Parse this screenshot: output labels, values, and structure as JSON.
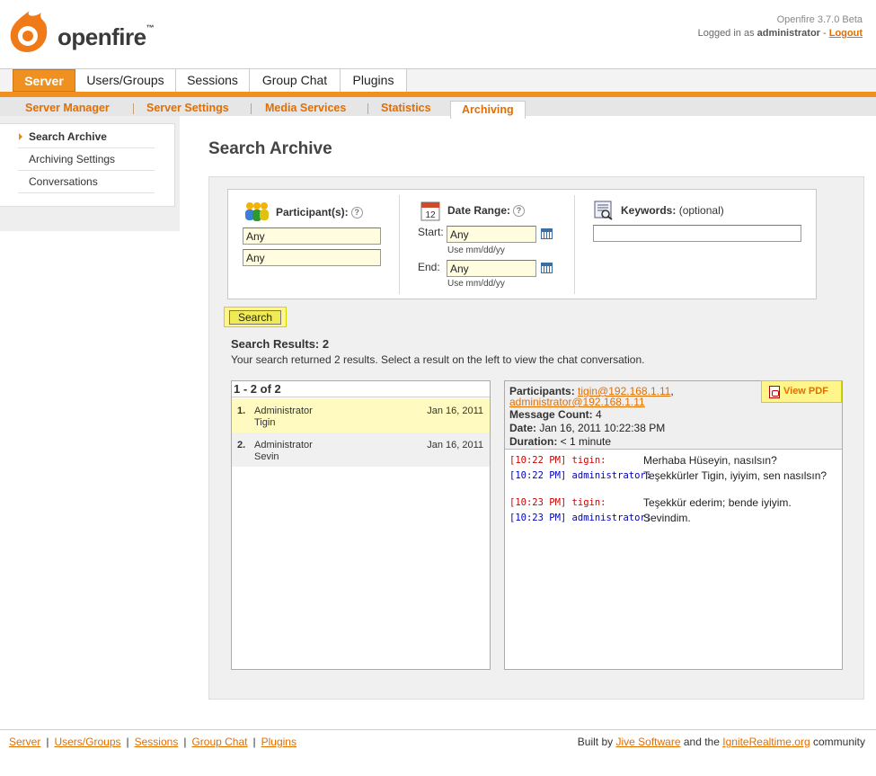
{
  "header": {
    "logo_text": "openfire",
    "logo_tm": "™",
    "version": "Openfire 3.7.0 Beta",
    "login_prefix": "Logged in as",
    "username": "administrator",
    "logout": "Logout"
  },
  "main_tabs": [
    "Server",
    "Users/Groups",
    "Sessions",
    "Group Chat",
    "Plugins"
  ],
  "sub_tabs": [
    "Server Manager",
    "Server Settings",
    "Media Services",
    "Statistics",
    "Archiving"
  ],
  "sidebar": {
    "items": [
      "Search Archive",
      "Archiving Settings",
      "Conversations"
    ]
  },
  "page_title": "Search Archive",
  "search": {
    "participants_label": "Participant(s):",
    "participant_1": "Any",
    "participant_2": "Any",
    "date_range_label": "Date Range:",
    "start_label": "Start:",
    "start_value": "Any",
    "end_label": "End:",
    "end_value": "Any",
    "date_hint": "Use mm/dd/yy",
    "keywords_label": "Keywords:",
    "keywords_optional": "(optional)",
    "keywords_value": "",
    "help_glyph": "?",
    "search_button": "Search"
  },
  "results": {
    "title": "Search Results: 2",
    "description": "Your search returned 2 results. Select a result on the left to view the chat conversation.",
    "range": "1 - 2 of 2",
    "items": [
      {
        "num": "1.",
        "from": "Administrator",
        "to": "Tigin",
        "date": "Jan 16, 2011"
      },
      {
        "num": "2.",
        "from": "Administrator",
        "to": "Sevin",
        "date": "Jan 16, 2011"
      }
    ]
  },
  "conversation": {
    "participants_label": "Participants:",
    "participant_1": "tigin@192.168.1.11",
    "participant_2": "administrator@192.168.1.11",
    "message_count_label": "Message Count:",
    "message_count": "4",
    "date_label": "Date:",
    "date": "Jan 16, 2011 10:22:38 PM",
    "duration_label": "Duration:",
    "duration": "< 1 minute",
    "view_pdf": "View PDF",
    "messages": [
      {
        "time": "[10:22 PM]",
        "user": "tigin:",
        "text": "Merhaba Hüseyin, nasılsın?"
      },
      {
        "time": "[10:22 PM]",
        "user": "administrator:",
        "text": "Teşekkürler Tigin, iyiyim, sen nasılsın?"
      },
      {
        "time": "[10:23 PM]",
        "user": "tigin:",
        "text": "Teşekkür ederim; bende iyiyim."
      },
      {
        "time": "[10:23 PM]",
        "user": "administrator:",
        "text": "Sevindim."
      }
    ]
  },
  "footer": {
    "links": [
      "Server",
      "Users/Groups",
      "Sessions",
      "Group Chat",
      "Plugins"
    ],
    "built_by": "Built by",
    "jive": "Jive Software",
    "and_the": "and the",
    "ignite": "IgniteRealtime.org",
    "community": "community"
  },
  "colors": {
    "accent": "#f09020",
    "link": "#e36e00",
    "highlight": "#fff58a"
  }
}
